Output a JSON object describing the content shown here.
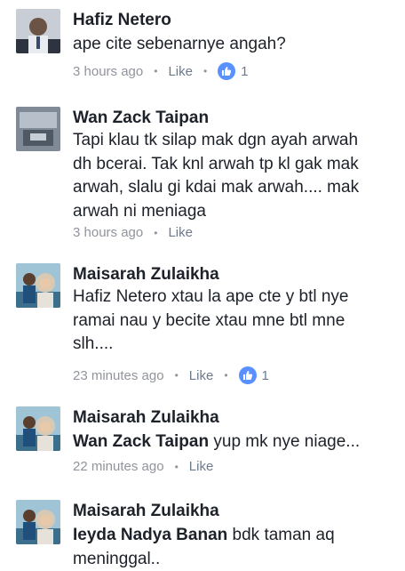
{
  "comments": [
    {
      "author": "Hafiz Netero",
      "text": "ape cite sebenarnye angah?",
      "time": "3 hours ago",
      "like_label": "Like",
      "like_count": "1"
    },
    {
      "author": "Wan Zack Taipan",
      "lines": [
        "Tapi klau tk silap mak dgn ayah arwah",
        "dh bcerai. Tak knl arwah tp kl gak mak",
        "arwah, slalu gi kdai mak arwah.... mak",
        "arwah ni meniaga"
      ],
      "time": "3 hours ago",
      "like_label": "Like"
    },
    {
      "author": "Maisarah Zulaikha",
      "lines": [
        "Hafiz Netero xtau la ape cte y btl nye",
        "ramai nau y becite xtau mne btl mne",
        "slh...."
      ],
      "time": "23 minutes ago",
      "like_label": "Like",
      "like_count": "1"
    },
    {
      "author": "Maisarah Zulaikha",
      "mention": "Wan Zack Taipan",
      "text": " yup mk nye niage...",
      "time": "22 minutes ago",
      "like_label": "Like"
    },
    {
      "author": "Maisarah Zulaikha",
      "mention": "Ieyda Nadya Banan",
      "text": " bdk taman aq",
      "line2": "meninggal.."
    }
  ],
  "icons": {
    "like_badge": "thumbs-up-icon",
    "separator": "•"
  },
  "colors": {
    "like_badge": "#5890ff",
    "meta_text": "#90949c"
  }
}
